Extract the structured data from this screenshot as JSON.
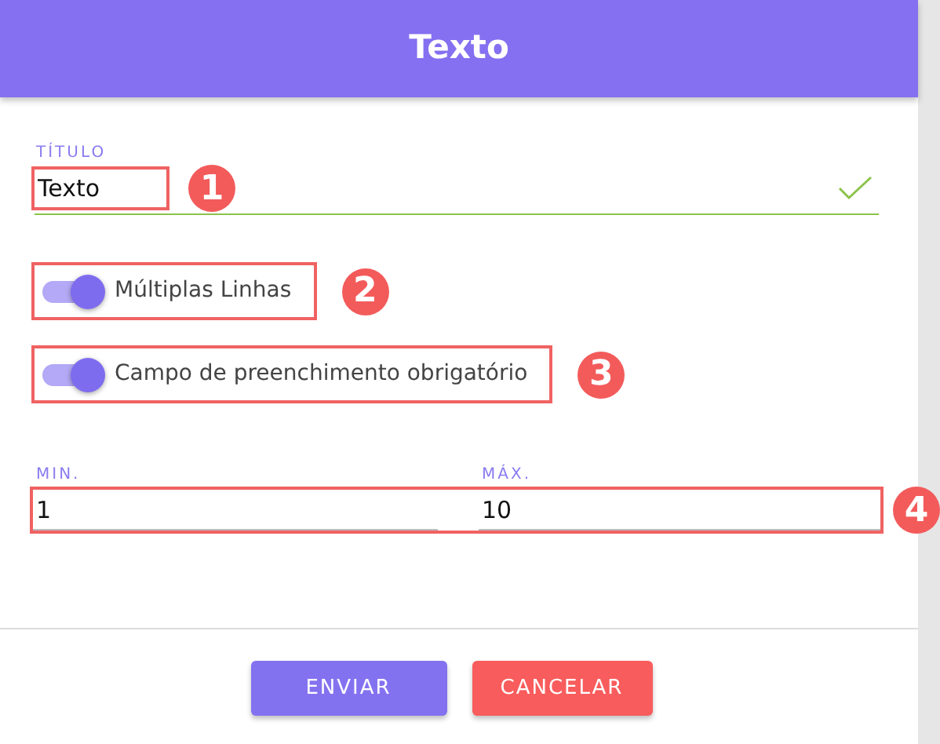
{
  "dialog": {
    "title": "Texto"
  },
  "title_field": {
    "label": "TÍTULO",
    "value": "Texto",
    "valid": true
  },
  "toggles": [
    {
      "label": "Múltiplas Linhas",
      "on": true
    },
    {
      "label": "Campo de preenchimento obrigatório",
      "on": true
    }
  ],
  "range_fields": [
    {
      "label": "MIN.",
      "value": "1"
    },
    {
      "label": "MÁX.",
      "value": "10"
    }
  ],
  "buttons": [
    {
      "label": "ENVIAR",
      "kind": "primary"
    },
    {
      "label": "CANCELAR",
      "kind": "danger"
    }
  ],
  "annotations": [
    "1",
    "2",
    "3",
    "4"
  ]
}
